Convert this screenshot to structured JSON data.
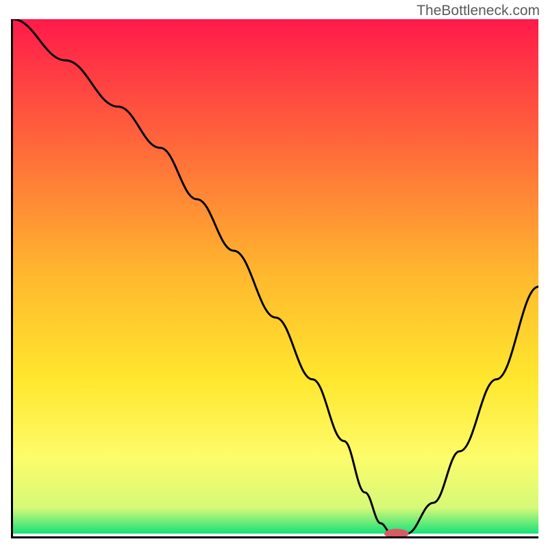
{
  "watermark": "TheBottleneck.com",
  "chart_data": {
    "type": "line",
    "title": "",
    "xlabel": "",
    "ylabel": "",
    "xlim": [
      0,
      100
    ],
    "ylim": [
      0,
      100
    ],
    "gradient_stops": [
      {
        "offset": 0,
        "color": "#ff1a4a"
      },
      {
        "offset": 25,
        "color": "#ff6a3a"
      },
      {
        "offset": 50,
        "color": "#ffb92e"
      },
      {
        "offset": 70,
        "color": "#ffe72e"
      },
      {
        "offset": 85,
        "color": "#fdfc6a"
      },
      {
        "offset": 95,
        "color": "#d6f978"
      },
      {
        "offset": 100,
        "color": "#16e17a"
      }
    ],
    "series": [
      {
        "name": "bottleneck-curve",
        "x": [
          0,
          10,
          20,
          28,
          35,
          42,
          50,
          57,
          63,
          67,
          70,
          72,
          75,
          80,
          85,
          92,
          100
        ],
        "y": [
          100,
          92,
          83,
          75,
          65,
          55,
          42,
          30,
          18,
          8,
          2,
          0,
          0,
          6,
          16,
          30,
          48
        ]
      }
    ],
    "marker": {
      "x": 73,
      "y": 0,
      "color": "#d85a66",
      "rx": 18,
      "ry": 7
    }
  }
}
